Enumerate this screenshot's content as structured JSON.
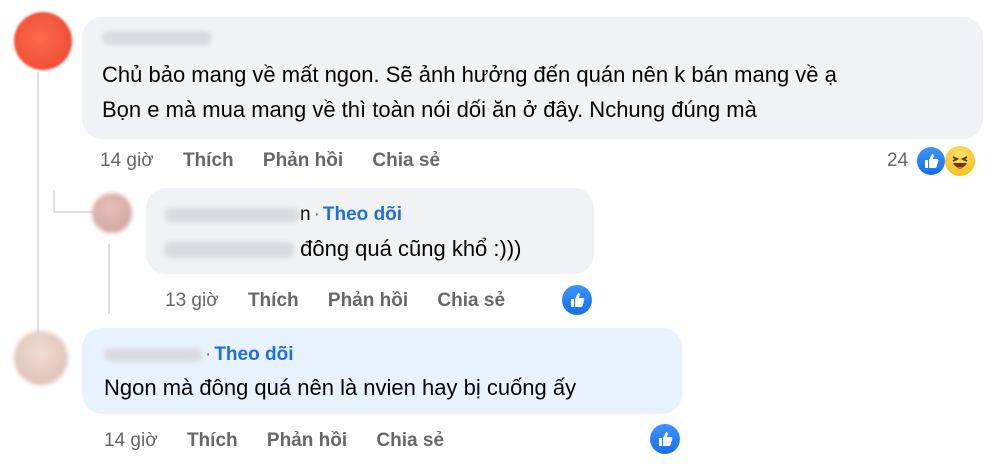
{
  "comments": [
    {
      "text_lines": [
        "Chủ bảo mang về mất ngon. Sẽ ảnh hưởng đến quán nên k bán mang về ạ",
        "Bọn e mà mua mang về thì toàn nói dối ăn ở đây. Nchung đúng mà"
      ],
      "time": "14 giờ",
      "like": "Thích",
      "reply": "Phản hồi",
      "share": "Chia sẻ",
      "reaction_count": "24"
    },
    {
      "name_suffix": "n",
      "follow": "Theo dõi",
      "text": "đông quá cũng khổ :)))",
      "time": "13 giờ",
      "like": "Thích",
      "reply": "Phản hồi",
      "share": "Chia sẻ"
    },
    {
      "follow": "Theo dõi",
      "text": "Ngon mà đông quá nên là nvien hay bị cuống ấy",
      "time": "14 giờ",
      "like": "Thích",
      "reply": "Phản hồi",
      "share": "Chia sẻ"
    }
  ],
  "colors": {
    "bubble_gray": "#f0f2f5",
    "bubble_blue": "#e7f3ff",
    "follow_blue": "#216fdb",
    "meta_gray": "#65676b"
  },
  "icons": [
    "like-icon",
    "haha-icon"
  ]
}
